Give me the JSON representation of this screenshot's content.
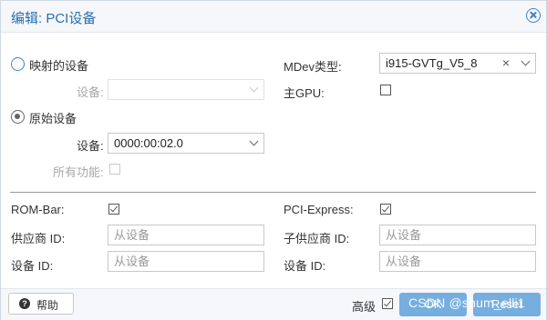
{
  "dialog": {
    "title": "编辑: PCI设备"
  },
  "mapped": {
    "radio_label": "映射的设备",
    "device_label": "设备:",
    "device_value": ""
  },
  "raw": {
    "radio_label": "原始设备",
    "device_label": "设备:",
    "device_value": "0000:00:02.0",
    "all_functions_label": "所有功能:"
  },
  "right": {
    "mdev_label": "MDev类型:",
    "mdev_value": "i915-GVTg_V5_8",
    "primary_gpu_label": "主GPU:"
  },
  "advanced": {
    "rombar_label": "ROM-Bar:",
    "pcie_label": "PCI-Express:",
    "vendor_id_label": "供应商 ID:",
    "vendor_id_placeholder": "从设备",
    "subvendor_id_label": "子供应商 ID:",
    "subvendor_id_placeholder": "从设备",
    "device_id_label": "设备 ID:",
    "device_id_placeholder": "从设备",
    "subdevice_id_label": "设备 ID:",
    "subdevice_id_placeholder": "从设备"
  },
  "footer": {
    "help_label": "帮助",
    "advanced_label": "高级",
    "ok_label": "OK",
    "reset_label": "Reset",
    "watermark": "CSDN @shum_elli1"
  },
  "colors": {
    "accent": "#2a6fb0",
    "button": "#76aee0"
  },
  "icons": {
    "close": "close-circle-icon",
    "help": "question-circle-icon",
    "dropdown": "chevron-down-icon"
  }
}
